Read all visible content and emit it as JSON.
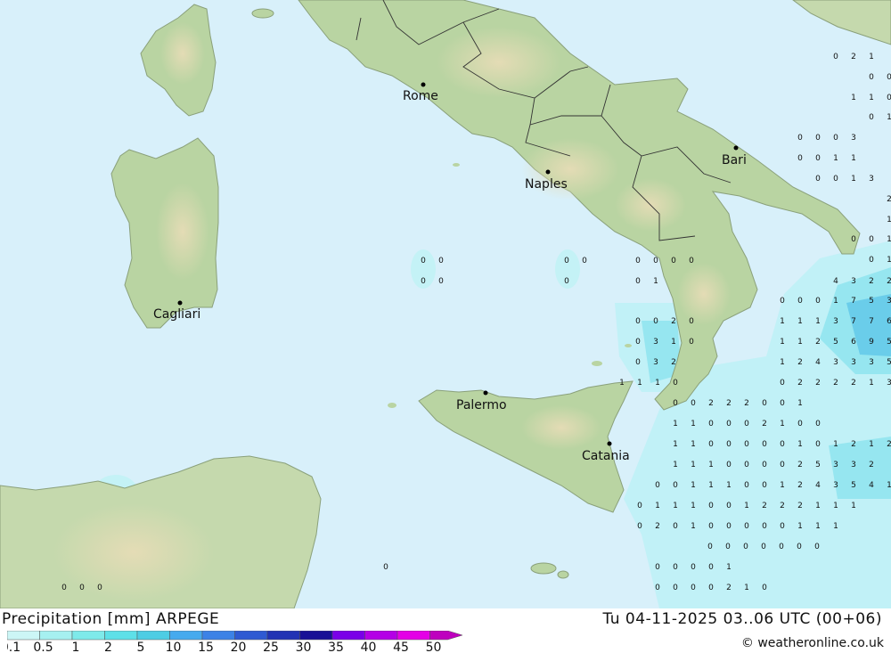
{
  "title": "Precipitation [mm] ARPEGE",
  "datetime": "Tu 04-11-2025 03..06 UTC (00+06)",
  "credit": "© weatheronline.co.uk",
  "colors": {
    "sea": "#d8f0fa",
    "land": "#b9d4a2",
    "land_highland": "#d9d8b0",
    "border": "#333333"
  },
  "cities": [
    {
      "name": "Rome"
    },
    {
      "name": "Naples"
    },
    {
      "name": "Bari"
    },
    {
      "name": "Cagliari"
    },
    {
      "name": "Palermo"
    },
    {
      "name": "Catania"
    }
  ],
  "scale": {
    "labels": [
      "0.1",
      "0.5",
      "1",
      "2",
      "5",
      "10",
      "15",
      "20",
      "25",
      "30",
      "35",
      "40",
      "45",
      "50"
    ],
    "colors": [
      "#ccf6f6",
      "#a6f0f0",
      "#7eeaea",
      "#5ee0e8",
      "#4ecde4",
      "#46aaee",
      "#3c82e6",
      "#2f5ad2",
      "#2233b4",
      "#180f96",
      "#7a00e8",
      "#b400e6",
      "#e400e6",
      "#be00be"
    ]
  },
  "precip_values": [
    [
      "0",
      "2",
      "1"
    ],
    [
      "0",
      "0"
    ],
    [
      "1",
      "1",
      "0"
    ],
    [
      "0",
      "1",
      "4"
    ],
    [
      "0",
      "0",
      "0",
      "3"
    ],
    [
      "0",
      "0",
      "1",
      "1"
    ],
    [
      "0",
      "0",
      "1",
      "3"
    ],
    [
      "2"
    ],
    [
      "1"
    ],
    [
      "0",
      "0",
      "1"
    ],
    [
      "0",
      "1"
    ],
    [
      "0",
      "0"
    ],
    [
      "0",
      "0"
    ],
    [
      "0",
      "0",
      "0",
      "0"
    ],
    [
      "0",
      "1"
    ],
    [
      "4",
      "3",
      "2",
      "2"
    ],
    [
      "0",
      "0",
      "0",
      "1",
      "7",
      "5",
      "3"
    ],
    [
      "0",
      "0",
      "2",
      "0"
    ],
    [
      "1",
      "1",
      "1",
      "3",
      "7",
      "7",
      "6"
    ],
    [
      "0",
      "3",
      "1",
      "0"
    ],
    [
      "1",
      "1",
      "2",
      "5",
      "6",
      "9",
      "5"
    ],
    [
      "0",
      "3",
      "2"
    ],
    [
      "1",
      "2",
      "4",
      "3",
      "3",
      "3",
      "5"
    ],
    [
      "1",
      "1",
      "1",
      "0"
    ],
    [
      "0",
      "2",
      "2",
      "2",
      "2",
      "1",
      "3"
    ],
    [
      "0",
      "0",
      "2",
      "2",
      "2",
      "0",
      "0",
      "1"
    ],
    [
      "1",
      "1",
      "0",
      "0",
      "0",
      "2",
      "1",
      "0",
      "0"
    ],
    [
      "1",
      "1",
      "0",
      "0",
      "0",
      "0",
      "0",
      "1",
      "0",
      "1",
      "2",
      "1",
      "2"
    ],
    [
      "1",
      "1",
      "1",
      "0",
      "0",
      "0",
      "0",
      "2",
      "5",
      "3",
      "3",
      "2"
    ],
    [
      "0",
      "0",
      "1",
      "1",
      "1",
      "0",
      "0",
      "1",
      "2",
      "4",
      "3",
      "5",
      "4",
      "1"
    ],
    [
      "0",
      "1",
      "1",
      "1",
      "0",
      "0",
      "1",
      "2",
      "2",
      "2",
      "1",
      "1",
      "1"
    ],
    [
      "0",
      "2",
      "0",
      "1",
      "0",
      "0",
      "0",
      "0",
      "0",
      "1",
      "1",
      "1"
    ],
    [
      "0",
      "0",
      "0",
      "0",
      "0",
      "0",
      "0"
    ],
    [
      "0",
      "0",
      "0",
      "0",
      "1"
    ],
    [
      "0",
      "0",
      "0",
      "0",
      "2",
      "1",
      "0"
    ],
    [
      "0",
      "0"
    ],
    [
      "0"
    ],
    [
      "0",
      "0",
      "0"
    ],
    [
      "0"
    ]
  ]
}
